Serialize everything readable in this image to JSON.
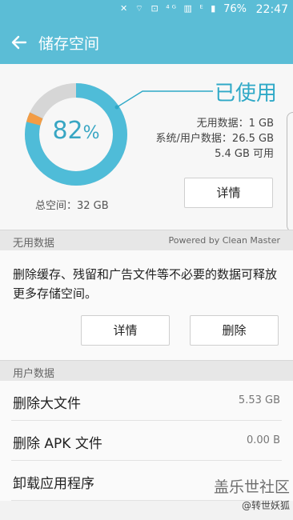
{
  "status_bar": {
    "icons": "✕ ⌔ ⊡ ⁴ᴳ ▥ ᴱ ▮",
    "battery": "76%",
    "time": "22:47"
  },
  "header": {
    "title": "储存空间"
  },
  "summary": {
    "percent": "82",
    "percent_unit": "%",
    "used_fraction": 0.82,
    "total": "总空间：32 GB",
    "used_label": "已使用",
    "stats": [
      "无用数据：1 GB",
      "系统/用户数据：26.5 GB",
      "5.4 GB 可用"
    ],
    "detail_button": "详情"
  },
  "junk_section": {
    "header": "无用数据",
    "powered_by": "Powered by Clean Master",
    "description": "删除缓存、残留和广告文件等不必要的数据可释放更多存储空间。",
    "detail_button": "详情",
    "delete_button": "删除"
  },
  "user_section": {
    "header": "用户数据",
    "items": [
      {
        "label": "删除大文件",
        "value": "5.53 GB"
      },
      {
        "label": "删除 APK 文件",
        "value": "0.00 B"
      },
      {
        "label": "卸载应用程序",
        "value": ""
      }
    ]
  },
  "watermark": {
    "line1": "盖乐世社区",
    "line2": "@转世妖狐"
  },
  "colors": {
    "accent": "#5bbdd6",
    "ring_used": "#4fbcd8",
    "ring_junk": "#f39c45",
    "ring_free": "#d6d6d6"
  }
}
